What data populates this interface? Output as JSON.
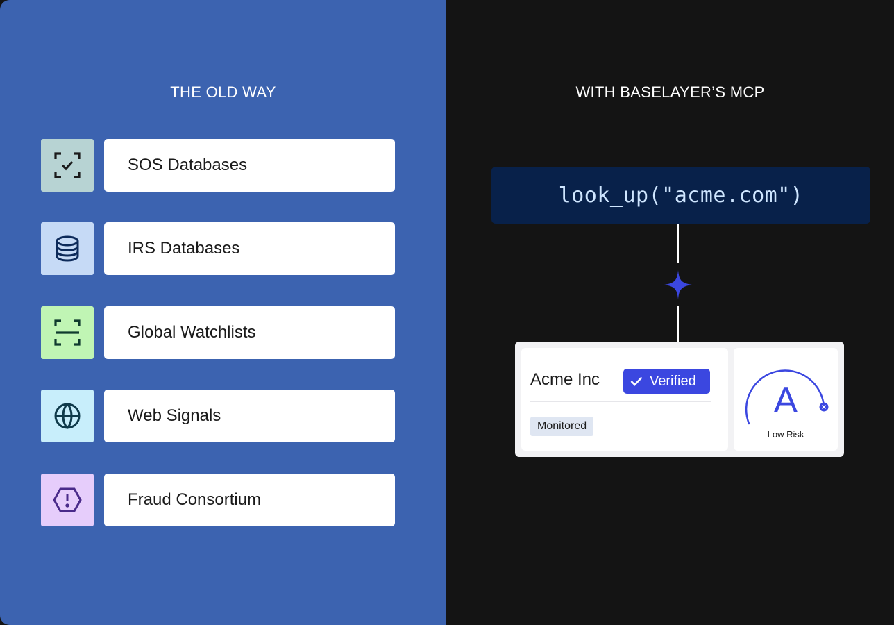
{
  "left": {
    "heading": "THE OLD WAY",
    "items": [
      {
        "label": "SOS Databases",
        "icon": "scan-check-icon",
        "bg": "#b7d3d3"
      },
      {
        "label": "IRS Databases",
        "icon": "database-icon",
        "bg": "#c6daf6"
      },
      {
        "label": "Global Watchlists",
        "icon": "scan-icon",
        "bg": "#c0f5b4"
      },
      {
        "label": "Web Signals",
        "icon": "globe-icon",
        "bg": "#c8eefb"
      },
      {
        "label": "Fraud Consortium",
        "icon": "alert-hexagon-icon",
        "bg": "#e6cdfb"
      }
    ]
  },
  "right": {
    "heading": "WITH BASELAYER’S MCP",
    "code": "look_up(\"acme.com\")",
    "result": {
      "company": "Acme Inc",
      "verified_label": "Verified",
      "monitored_label": "Monitored",
      "grade": "A",
      "risk_label": "Low Risk"
    }
  },
  "colors": {
    "left_bg": "#3c63b0",
    "right_bg": "#141414",
    "code_bg": "#08214a",
    "accent": "#3b47e0"
  }
}
